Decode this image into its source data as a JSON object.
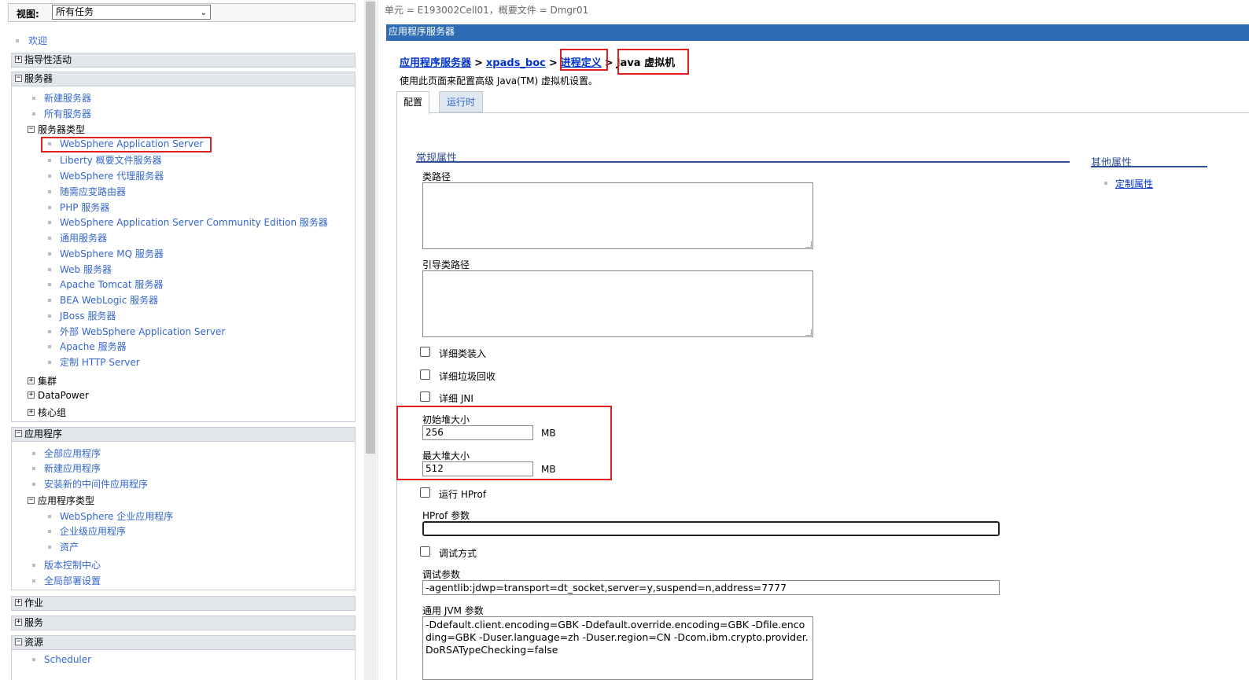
{
  "nav": {
    "view_label": "视图:",
    "view_select": "所有任务",
    "welcome": "欢迎",
    "sections": {
      "guided": "指导性活动",
      "servers": "服务器",
      "applications": "应用程序",
      "jobs": "作业",
      "services": "服务",
      "resources": "资源"
    },
    "servers": {
      "new_server": "新建服务器",
      "all_servers": "所有服务器",
      "server_types": "服务器类型",
      "types": [
        "WebSphere Application Server",
        "Liberty 概要文件服务器",
        "WebSphere 代理服务器",
        "随需应变路由器",
        "PHP 服务器",
        "WebSphere Application Server Community Edition 服务器",
        "通用服务器",
        "WebSphere MQ 服务器",
        "Web 服务器",
        "Apache Tomcat 服务器",
        "BEA WebLogic 服务器",
        "JBoss 服务器",
        "外部 WebSphere Application Server",
        "Apache 服务器",
        "定制 HTTP Server"
      ],
      "clusters": "集群",
      "datapower": "DataPower",
      "core_groups": "核心组"
    },
    "applications": {
      "all_apps": "全部应用程序",
      "new_app": "新建应用程序",
      "install_middleware": "安装新的中间件应用程序",
      "app_types": "应用程序类型",
      "types": [
        "WebSphere 企业应用程序",
        "企业级应用程序",
        "资产"
      ],
      "version_control": "版本控制中心",
      "global_deploy": "全局部署设置"
    },
    "resources": {
      "scheduler": "Scheduler"
    }
  },
  "content": {
    "cell_info": "单元 = E193002Cell01，概要文件 = Dmgr01",
    "title": "应用程序服务器",
    "breadcrumb": {
      "app_servers": "应用程序服务器",
      "server": "xpads_boc",
      "process_def": "进程定义",
      "current": "Java 虚拟机",
      "sep": ">"
    },
    "description": "使用此页面来配置高级 Java(TM) 虚拟机设置。",
    "tabs": {
      "config": "配置",
      "runtime": "运行时"
    },
    "general_properties": "常规属性",
    "other_properties": "其他属性",
    "custom_properties": "定制属性",
    "fields": {
      "classpath_label": "类路径",
      "classpath_value": "",
      "boot_classpath_label": "引导类路径",
      "boot_classpath_value": "",
      "verbose_class": "详细类装入",
      "verbose_gc": "详细垃圾回收",
      "verbose_jni": "详细 JNI",
      "initial_heap_label": "初始堆大小",
      "initial_heap_value": "256",
      "max_heap_label": "最大堆大小",
      "max_heap_value": "512",
      "heap_unit": "MB",
      "run_hprof": "运行 HProf",
      "hprof_args_label": "HProf 参数",
      "hprof_args_value": "",
      "debug_mode": "调试方式",
      "debug_args_label": "调试参数",
      "debug_args_value": "-agentlib:jdwp=transport=dt_socket,server=y,suspend=n,address=7777",
      "jvm_args_label": "通用 JVM 参数",
      "jvm_args_value": "-Ddefault.client.encoding=GBK -Ddefault.override.encoding=GBK -Dfile.encoding=GBK -Duser.language=zh -Duser.region=CN -Dcom.ibm.crypto.provider.DoRSATypeChecking=false"
    }
  },
  "colors": {
    "title_bar": "#2f6cb6",
    "link": "#3366cc",
    "highlight": "#e02020"
  }
}
